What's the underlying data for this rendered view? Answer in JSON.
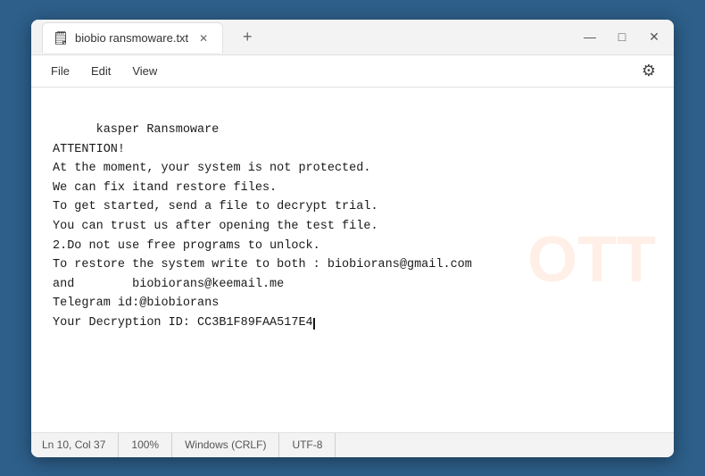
{
  "window": {
    "title": "biobio ransmoware.txt",
    "tab_icon": "🗒",
    "controls": {
      "minimize": "—",
      "maximize": "□",
      "close": "✕"
    }
  },
  "menubar": {
    "items": [
      "File",
      "Edit",
      "View"
    ],
    "settings_icon": "⚙"
  },
  "content": {
    "lines": [
      "kasper Ransmoware",
      "ATTENTION!",
      "At the moment, your system is not protected.",
      "We can fix itand restore files.",
      "To get started, send a file to decrypt trial.",
      "You can trust us after opening the test file.",
      "2.Do not use free programs to unlock.",
      "To restore the system write to both : biobiorans@gmail.com",
      "and        biobiorans@keemail.me",
      "Telegram id:@biobiorans",
      "Your Decryption ID: CC3B1F89FAA517E4"
    ]
  },
  "statusbar": {
    "position": "Ln 10, Col 37",
    "zoom": "100%",
    "line_ending": "Windows (CRLF)",
    "encoding": "UTF-8"
  },
  "watermark": {
    "text": "OTT"
  }
}
